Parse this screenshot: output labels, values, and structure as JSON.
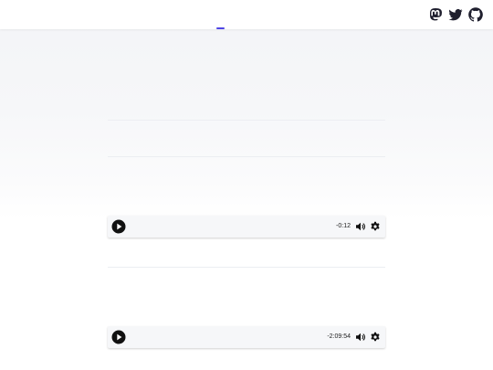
{
  "header": {
    "social": [
      {
        "icon": "mastodon-icon"
      },
      {
        "icon": "twitter-icon"
      },
      {
        "icon": "github-icon"
      }
    ],
    "accent_color": "#4f46e5",
    "icon_color": "#1f1f2e"
  },
  "players": [
    {
      "time": "-0:12",
      "play_icon": "play-icon",
      "volume_icon": "volume-icon",
      "settings_icon": "gear-icon"
    },
    {
      "time": "-2:09:54",
      "play_icon": "play-icon",
      "volume_icon": "volume-icon",
      "settings_icon": "gear-icon"
    }
  ]
}
